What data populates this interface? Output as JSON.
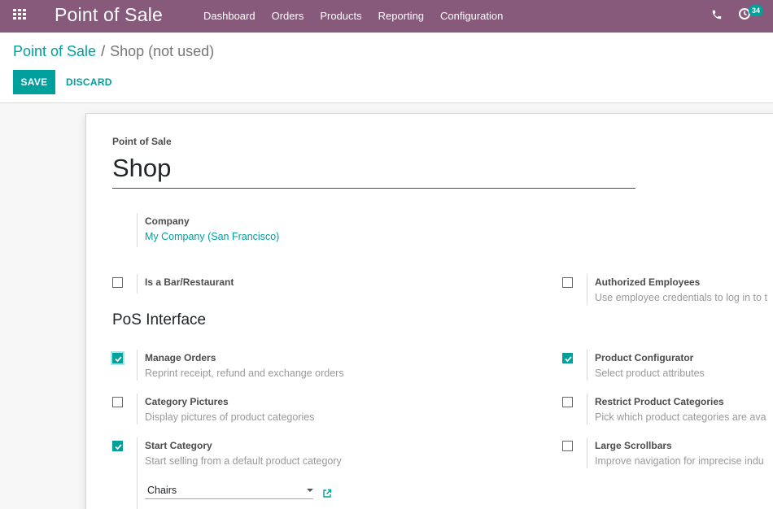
{
  "navbar": {
    "brand": "Point of Sale",
    "menu": [
      "Dashboard",
      "Orders",
      "Products",
      "Reporting",
      "Configuration"
    ],
    "activity_count": "34",
    "icons": [
      "apps-grid-icon",
      "phone-icon",
      "activity-clock-icon"
    ]
  },
  "breadcrumb": {
    "parent": "Point of Sale",
    "separator": "/",
    "current": "Shop (not used)"
  },
  "buttons": {
    "save": "SAVE",
    "discard": "DISCARD"
  },
  "form": {
    "title_label": "Point of Sale",
    "name": "Shop",
    "company_label": "Company",
    "company_value": "My Company (San Francisco)",
    "section_title": "PoS Interface",
    "settings": [
      {
        "label": "Is a Bar/Restaurant",
        "desc": "",
        "checked": false
      },
      {
        "label": "Authorized Employees",
        "desc": "Use employee credentials to log in to t",
        "checked": false
      },
      {
        "label": "Manage Orders",
        "desc": "Reprint receipt, refund and exchange orders",
        "checked": true
      },
      {
        "label": "Product Configurator",
        "desc": "Select product attributes",
        "checked": true
      },
      {
        "label": "Category Pictures",
        "desc": "Display pictures of product categories",
        "checked": false
      },
      {
        "label": "Restrict Product Categories",
        "desc": "Pick which product categories are ava",
        "checked": false
      },
      {
        "label": "Start Category",
        "desc": "Start selling from a default product category",
        "checked": true
      },
      {
        "label": "Large Scrollbars",
        "desc": "Improve navigation for imprecise indu",
        "checked": false
      }
    ],
    "start_category_value": "Chairs"
  },
  "colors": {
    "navbar": "#875a7b",
    "accent": "#00a09d"
  }
}
